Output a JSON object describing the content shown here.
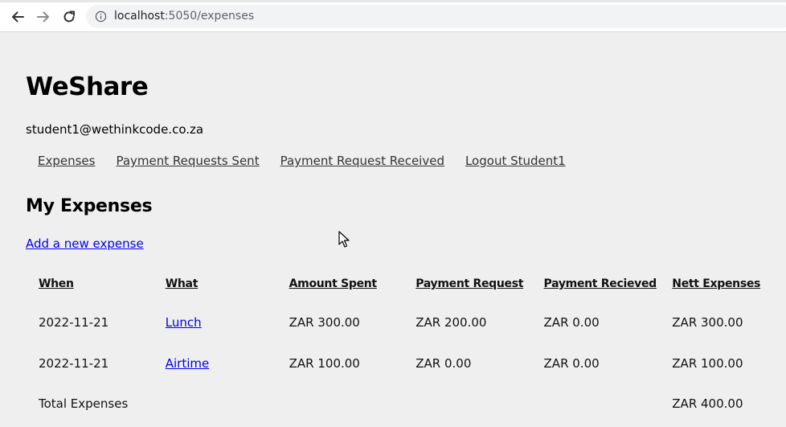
{
  "browser": {
    "url_host": "localhost",
    "url_rest": ":5050/expenses"
  },
  "page": {
    "site_title": "WeShare",
    "user_email": "student1@wethinkcode.co.za",
    "nav": [
      "Expenses",
      "Payment Requests Sent",
      "Payment Request Received",
      "Logout Student1"
    ],
    "section_title": "My Expenses",
    "add_expense_link": "Add a new expense"
  },
  "table": {
    "headers": [
      "When",
      "What",
      "Amount Spent",
      "Payment Request",
      "Payment Recieved",
      "Nett Expenses"
    ],
    "rows": [
      {
        "when": "2022-11-21",
        "what": "Lunch",
        "amount_spent": "ZAR 300.00",
        "payment_request": "ZAR 200.00",
        "payment_received": "ZAR 0.00",
        "nett_expenses": "ZAR 300.00"
      },
      {
        "when": "2022-11-21",
        "what": "Airtime",
        "amount_spent": "ZAR 100.00",
        "payment_request": "ZAR 0.00",
        "payment_received": "ZAR 0.00",
        "nett_expenses": "ZAR 100.00"
      }
    ],
    "total_label": "Total Expenses",
    "total_value": "ZAR 400.00"
  },
  "icons": {
    "back": "arrow-left-icon",
    "forward": "arrow-right-icon",
    "reload": "reload-icon",
    "site_info": "info-icon",
    "cursor": "mouse-pointer-icon"
  },
  "colors": {
    "page_background": "#efefef",
    "link_blue": "#0000ee",
    "nav_link_gray": "#333333"
  }
}
